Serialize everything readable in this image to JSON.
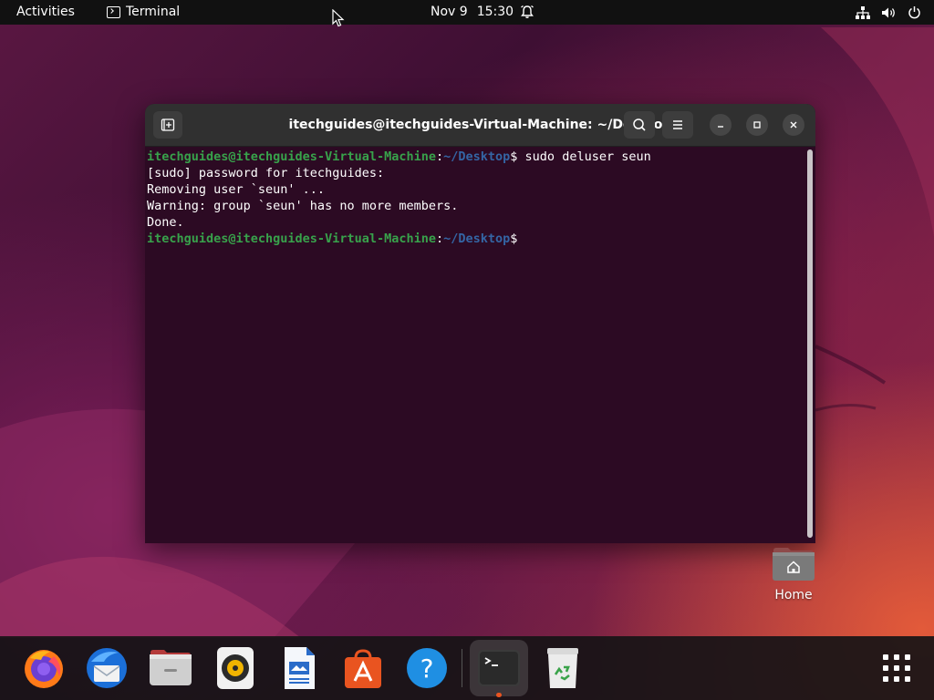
{
  "topbar": {
    "activities": "Activities",
    "app_name": "Terminal",
    "date": "Nov 9",
    "time": "15:30"
  },
  "window": {
    "title": "itechguides@itechguides-Virtual-Machine: ~/Desktop"
  },
  "terminal": {
    "prompt_user_host": "itechguides@itechguides-Virtual-Machine",
    "prompt_path": "~/Desktop",
    "command": " sudo deluser seun",
    "output": [
      "[sudo] password for itechguides:",
      "Removing user `seun' ...",
      "Warning: group `seun' has no more members.",
      "Done."
    ]
  },
  "desktop": {
    "home_label": "Home"
  },
  "dock": {
    "items": [
      "firefox",
      "thunderbird",
      "files",
      "rhythmbox",
      "libreoffice-writer",
      "app-center",
      "help",
      "terminal",
      "trash"
    ]
  },
  "colors": {
    "prompt_user": "#38a24b",
    "prompt_path": "#3465a4",
    "terminal_bg": "#2c0a23",
    "accent": "#e95420"
  }
}
